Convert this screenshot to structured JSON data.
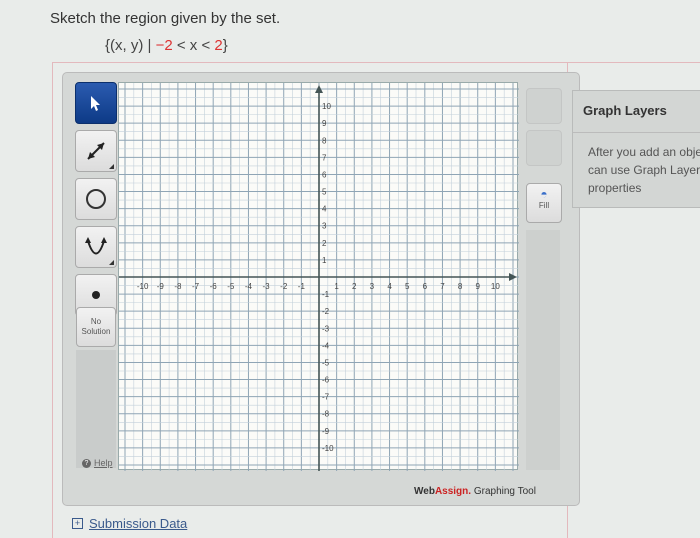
{
  "question": {
    "prompt": "Sketch the region given by the set.",
    "set_open": "{(x, y) | ",
    "lower": "−2",
    "lt1": " < x < ",
    "upper": "2",
    "set_close": "}"
  },
  "toolbar": {
    "tools": [
      {
        "name": "select",
        "icon": "pointer-icon",
        "active": true
      },
      {
        "name": "line",
        "icon": "line-arrow-icon",
        "active": false
      },
      {
        "name": "circle",
        "icon": "circle-icon",
        "active": false
      },
      {
        "name": "parabola",
        "icon": "parabola-icon",
        "active": false
      },
      {
        "name": "point",
        "icon": "point-icon",
        "active": false
      }
    ],
    "no_solution_label_1": "No",
    "no_solution_label_2": "Solution",
    "help_label": "Help"
  },
  "right_tools": {
    "fill_label": "Fill"
  },
  "graph": {
    "x_range": [
      -10,
      10
    ],
    "y_range": [
      -10,
      10
    ],
    "x_ticks": [
      "-10",
      "-9",
      "-8",
      "-7",
      "-6",
      "-5",
      "-4",
      "-3",
      "-2",
      "-1",
      "1",
      "2",
      "3",
      "4",
      "5",
      "6",
      "7",
      "8",
      "9",
      "10"
    ],
    "y_ticks": [
      "10",
      "9",
      "8",
      "7",
      "6",
      "5",
      "4",
      "3",
      "2",
      "1",
      "-1",
      "-2",
      "-3",
      "-4",
      "-5",
      "-6",
      "-7",
      "-8",
      "-9",
      "-10"
    ]
  },
  "brand": {
    "web": "Web",
    "assign": "Assign.",
    "suffix": " Graphing Tool"
  },
  "layers": {
    "title": "Graph Layers",
    "line1": "After you add an obje",
    "line2": "can use Graph Layers",
    "line3": "properties"
  },
  "submission": {
    "label": "Submission Data"
  }
}
